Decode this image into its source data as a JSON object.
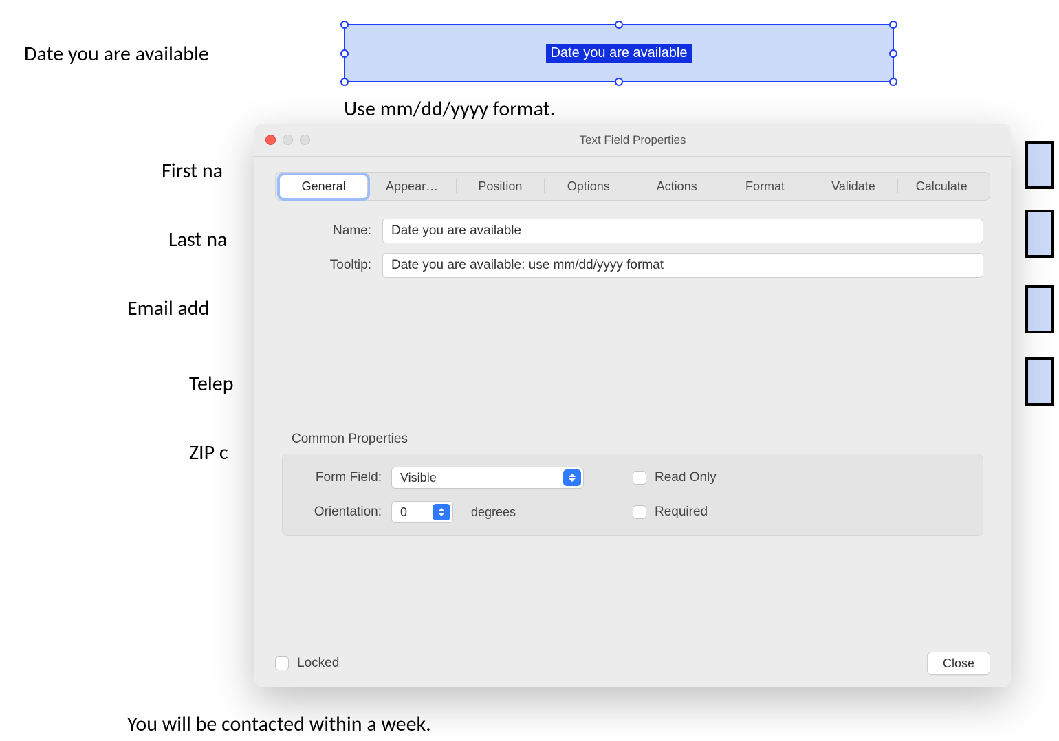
{
  "pdf": {
    "labels": {
      "date": "Date you are available",
      "hint": "Use mm/dd/yyyy format.",
      "first": "First na",
      "last": "Last na",
      "email": "Email add",
      "tel": "Telep",
      "zip": "ZIP c",
      "contacted": "You will be contacted within a week."
    },
    "selected_field_label": "Date you are available"
  },
  "dialog": {
    "title": "Text Field Properties",
    "tabs": {
      "general": "General",
      "appearance": "Appear…",
      "position": "Position",
      "options": "Options",
      "actions": "Actions",
      "format": "Format",
      "validate": "Validate",
      "calculate": "Calculate"
    },
    "name_label": "Name:",
    "name_value": "Date you are available",
    "tooltip_label": "Tooltip:",
    "tooltip_value": "Date you are available: use mm/dd/yyyy format",
    "common": {
      "heading": "Common Properties",
      "form_field_label": "Form Field:",
      "form_field_value": "Visible",
      "orientation_label": "Orientation:",
      "orientation_value": "0",
      "degrees": "degrees",
      "read_only": "Read Only",
      "required": "Required"
    },
    "locked_label": "Locked",
    "close_label": "Close"
  }
}
